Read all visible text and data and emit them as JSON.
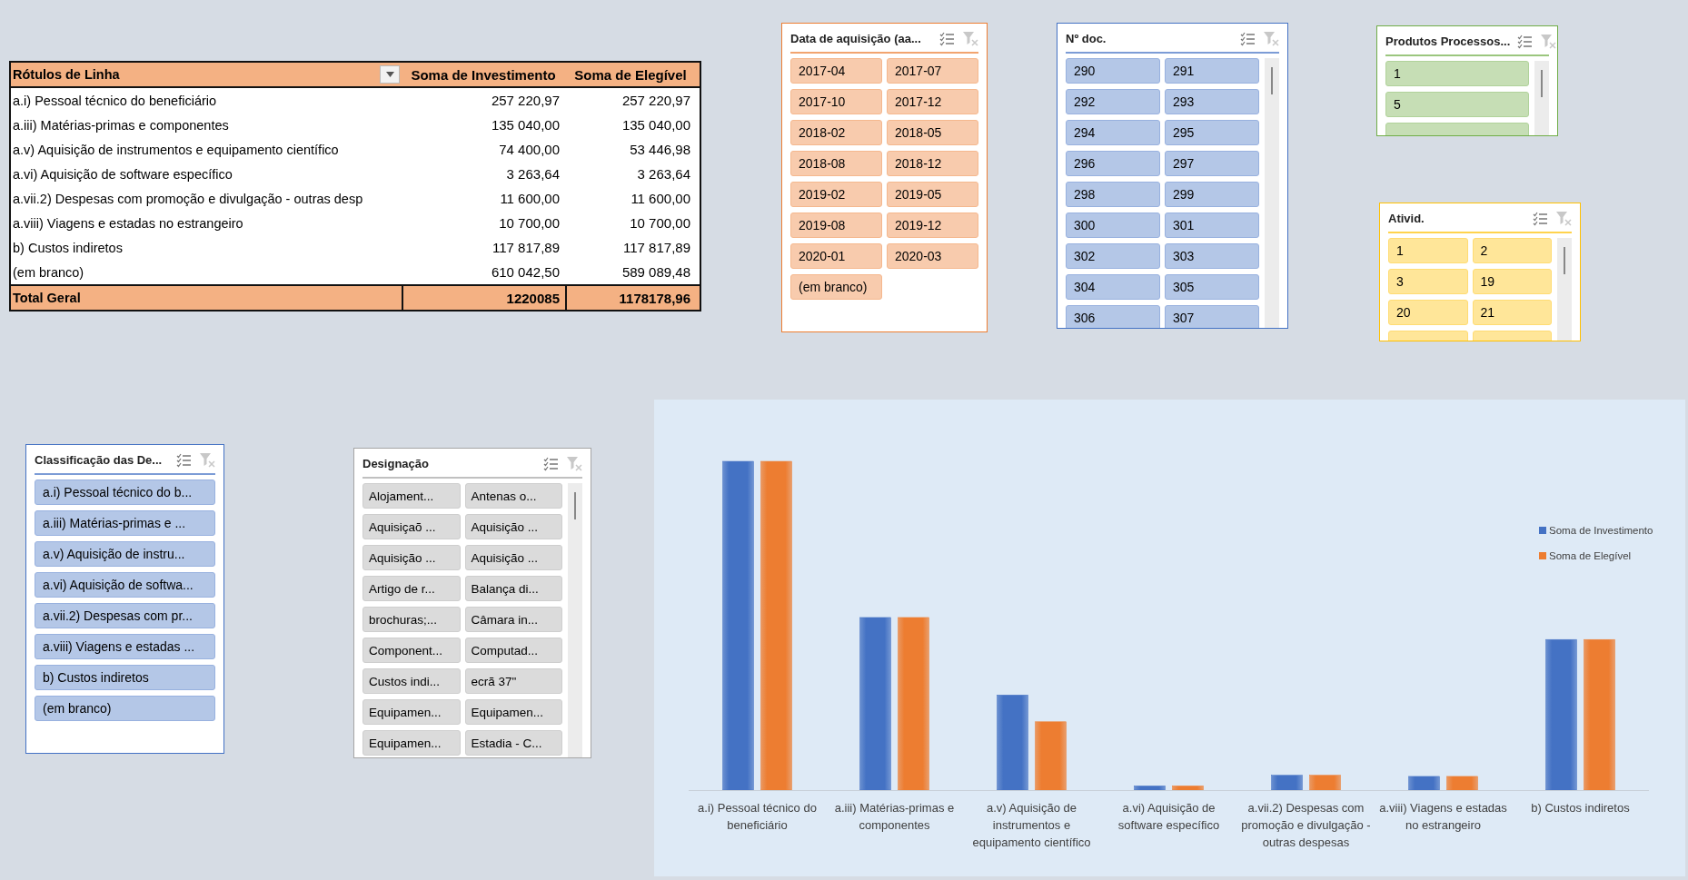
{
  "pivot": {
    "columns": [
      {
        "label": "Rótulos de Linha",
        "filter_button": true
      },
      {
        "label": "Soma de Investimento",
        "filter_button": false
      },
      {
        "label": "Soma de Elegível",
        "filter_button": false
      }
    ],
    "rows": [
      {
        "label": "a.i) Pessoal técnico do beneficiário",
        "investimento": "257 220,97",
        "elegivel": "257 220,97"
      },
      {
        "label": "a.iii) Matérias-primas e componentes",
        "investimento": "135 040,00",
        "elegivel": "135 040,00"
      },
      {
        "label": "a.v) Aquisição de instrumentos e equipamento científico",
        "investimento": "74 400,00",
        "elegivel": "53 446,98"
      },
      {
        "label": "a.vi) Aquisição de software específico",
        "investimento": "3 263,64",
        "elegivel": "3 263,64"
      },
      {
        "label": "a.vii.2) Despesas com promoção e divulgação - outras desp",
        "investimento": "11 600,00",
        "elegivel": "11 600,00"
      },
      {
        "label": "a.viii) Viagens e estadas no estrangeiro",
        "investimento": "10 700,00",
        "elegivel": "10 700,00"
      },
      {
        "label": "b) Custos indiretos",
        "investimento": "117 817,89",
        "elegivel": "117 817,89"
      },
      {
        "label": "(em branco)",
        "investimento": "610 042,50",
        "elegivel": "589 089,48"
      }
    ],
    "total": {
      "label": "Total Geral",
      "investimento": "1220085",
      "elegivel": "1178178,96"
    }
  },
  "slicers": [
    {
      "title": "Data de aquisição (aa...",
      "color": "#ed7d31",
      "scrollbar": false,
      "more_below": false,
      "items": [
        {
          "label": "2017-04",
          "selected": true
        },
        {
          "label": "2017-07",
          "selected": true
        },
        {
          "label": "2017-10",
          "selected": true
        },
        {
          "label": "2017-12",
          "selected": true
        },
        {
          "label": "2018-02",
          "selected": true
        },
        {
          "label": "2018-05",
          "selected": true
        },
        {
          "label": "2018-08",
          "selected": true
        },
        {
          "label": "2018-12",
          "selected": true
        },
        {
          "label": "2019-02",
          "selected": true
        },
        {
          "label": "2019-05",
          "selected": true
        },
        {
          "label": "2019-08",
          "selected": true
        },
        {
          "label": "2019-12",
          "selected": true
        },
        {
          "label": "2020-01",
          "selected": true
        },
        {
          "label": "2020-03",
          "selected": true
        },
        {
          "label": "(em branco)",
          "selected": true
        }
      ]
    },
    {
      "title": "Nº doc.",
      "color": "#4472c4",
      "scrollbar": true,
      "more_below": false,
      "items": [
        {
          "label": "290",
          "selected": true
        },
        {
          "label": "291",
          "selected": true
        },
        {
          "label": "292",
          "selected": true
        },
        {
          "label": "293",
          "selected": true
        },
        {
          "label": "294",
          "selected": true
        },
        {
          "label": "295",
          "selected": true
        },
        {
          "label": "296",
          "selected": true
        },
        {
          "label": "297",
          "selected": true
        },
        {
          "label": "298",
          "selected": true
        },
        {
          "label": "299",
          "selected": true
        },
        {
          "label": "300",
          "selected": true
        },
        {
          "label": "301",
          "selected": true
        },
        {
          "label": "302",
          "selected": true
        },
        {
          "label": "303",
          "selected": true
        },
        {
          "label": "304",
          "selected": true
        },
        {
          "label": "305",
          "selected": true
        },
        {
          "label": "306",
          "selected": true
        },
        {
          "label": "307",
          "selected": true
        }
      ]
    },
    {
      "title": "Produtos Processos...",
      "color": "#70ad47",
      "scrollbar": true,
      "more_below": true,
      "items": [
        {
          "label": "1",
          "selected": true
        },
        {
          "label": "5",
          "selected": true
        }
      ]
    },
    {
      "title": "Ativid.",
      "color": "#ffc000",
      "scrollbar": true,
      "more_below": true,
      "items": [
        {
          "label": "1",
          "selected": true
        },
        {
          "label": "2",
          "selected": true
        },
        {
          "label": "3",
          "selected": true
        },
        {
          "label": "19",
          "selected": true
        },
        {
          "label": "20",
          "selected": true
        },
        {
          "label": "21",
          "selected": true
        }
      ]
    },
    {
      "title": "Classificação das De...",
      "color": "#4472c4",
      "scrollbar": false,
      "more_below": false,
      "items": [
        {
          "label": "a.i) Pessoal técnico do b...",
          "selected": true
        },
        {
          "label": "a.iii) Matérias-primas e ...",
          "selected": true
        },
        {
          "label": "a.v) Aquisição de instru...",
          "selected": true
        },
        {
          "label": "a.vi) Aquisição de softwa...",
          "selected": true
        },
        {
          "label": "a.vii.2) Despesas com pr...",
          "selected": true
        },
        {
          "label": "a.viii) Viagens e estadas ...",
          "selected": true
        },
        {
          "label": "b) Custos indiretos",
          "selected": true
        },
        {
          "label": "(em branco)",
          "selected": true
        }
      ]
    },
    {
      "title": "Designação",
      "color": "#a5a5a5",
      "scrollbar": true,
      "more_below": false,
      "items": [
        {
          "label": "Alojament...",
          "selected": true
        },
        {
          "label": "Antenas o...",
          "selected": true
        },
        {
          "label": "Aquisiçaõ ...",
          "selected": true
        },
        {
          "label": "Aquisição ...",
          "selected": true
        },
        {
          "label": "Aquisição ...",
          "selected": true
        },
        {
          "label": "Aquisição ...",
          "selected": true
        },
        {
          "label": "Artigo de r...",
          "selected": true
        },
        {
          "label": "Balança di...",
          "selected": true
        },
        {
          "label": "brochuras;...",
          "selected": true
        },
        {
          "label": "Câmara in...",
          "selected": true
        },
        {
          "label": "Component...",
          "selected": true
        },
        {
          "label": "Computad...",
          "selected": true
        },
        {
          "label": "Custos indi...",
          "selected": true
        },
        {
          "label": "ecrã 37\"",
          "selected": true
        },
        {
          "label": "Equipamen...",
          "selected": true
        },
        {
          "label": "Equipamen...",
          "selected": true
        },
        {
          "label": "Equipamen...",
          "selected": true
        },
        {
          "label": "Estadia - C...",
          "selected": true
        }
      ]
    }
  ],
  "chart": {
    "categories": [
      "a.i) Pessoal técnico do beneficiário",
      "a.iii) Matérias-primas e componentes",
      "a.v) Aquisição de instrumentos e equipamento científico",
      "a.vi) Aquisição de software específico",
      "a.vii.2) Despesas com promoção e divulgação - outras despesas",
      "a.viii) Viagens e estadas no estrangeiro",
      "b) Custos indiretos"
    ],
    "legend": [
      {
        "label": "Soma de Investimento",
        "color": "#4472c4"
      },
      {
        "label": "Soma de Elegível",
        "color": "#ed7d31"
      }
    ]
  }
}
